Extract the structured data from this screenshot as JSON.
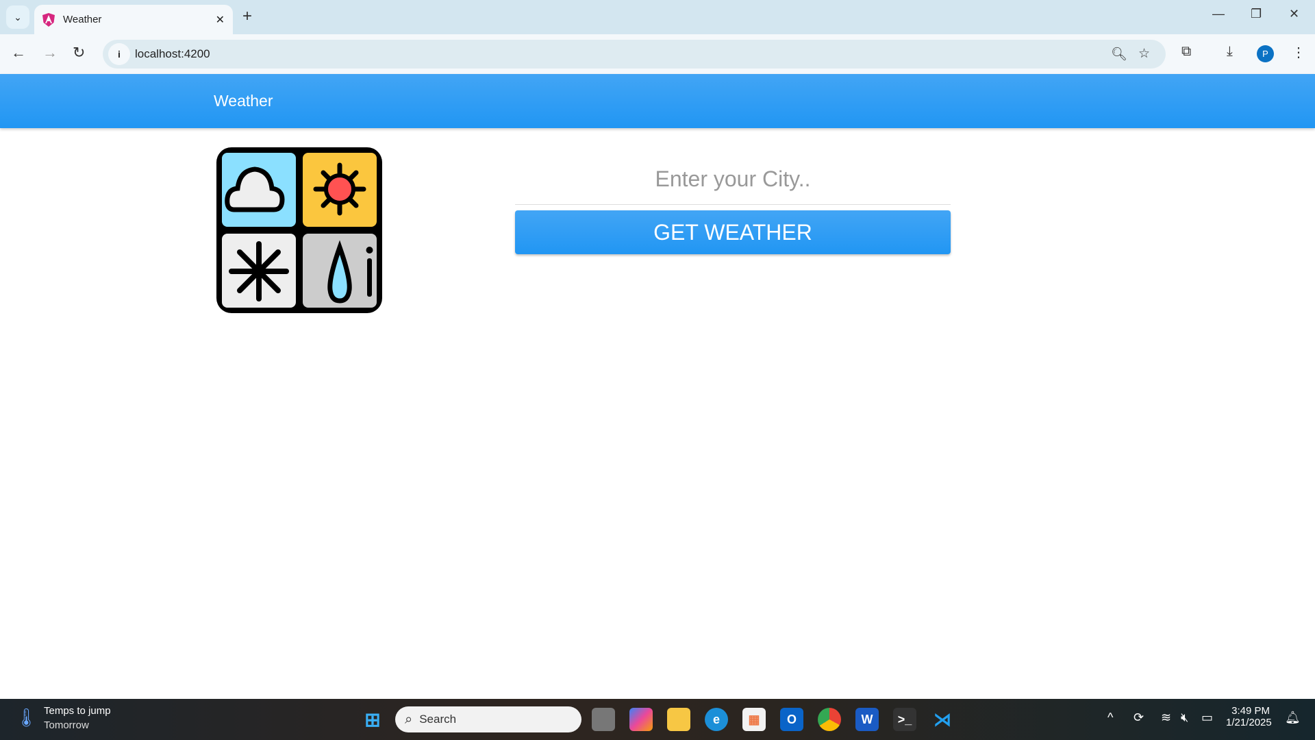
{
  "browser": {
    "tab_title": "Weather",
    "url": "localhost:4200",
    "profile_initial": "P"
  },
  "app": {
    "title": "Weather",
    "city_placeholder": "Enter your City..",
    "city_value": "",
    "button_label": "GET WEATHER",
    "accent_color": "#2196f3"
  },
  "taskbar": {
    "weather_title": "Temps to jump",
    "weather_sub": "Tomorrow",
    "search_label": "Search",
    "time": "3:49 PM",
    "date": "1/21/2025"
  }
}
